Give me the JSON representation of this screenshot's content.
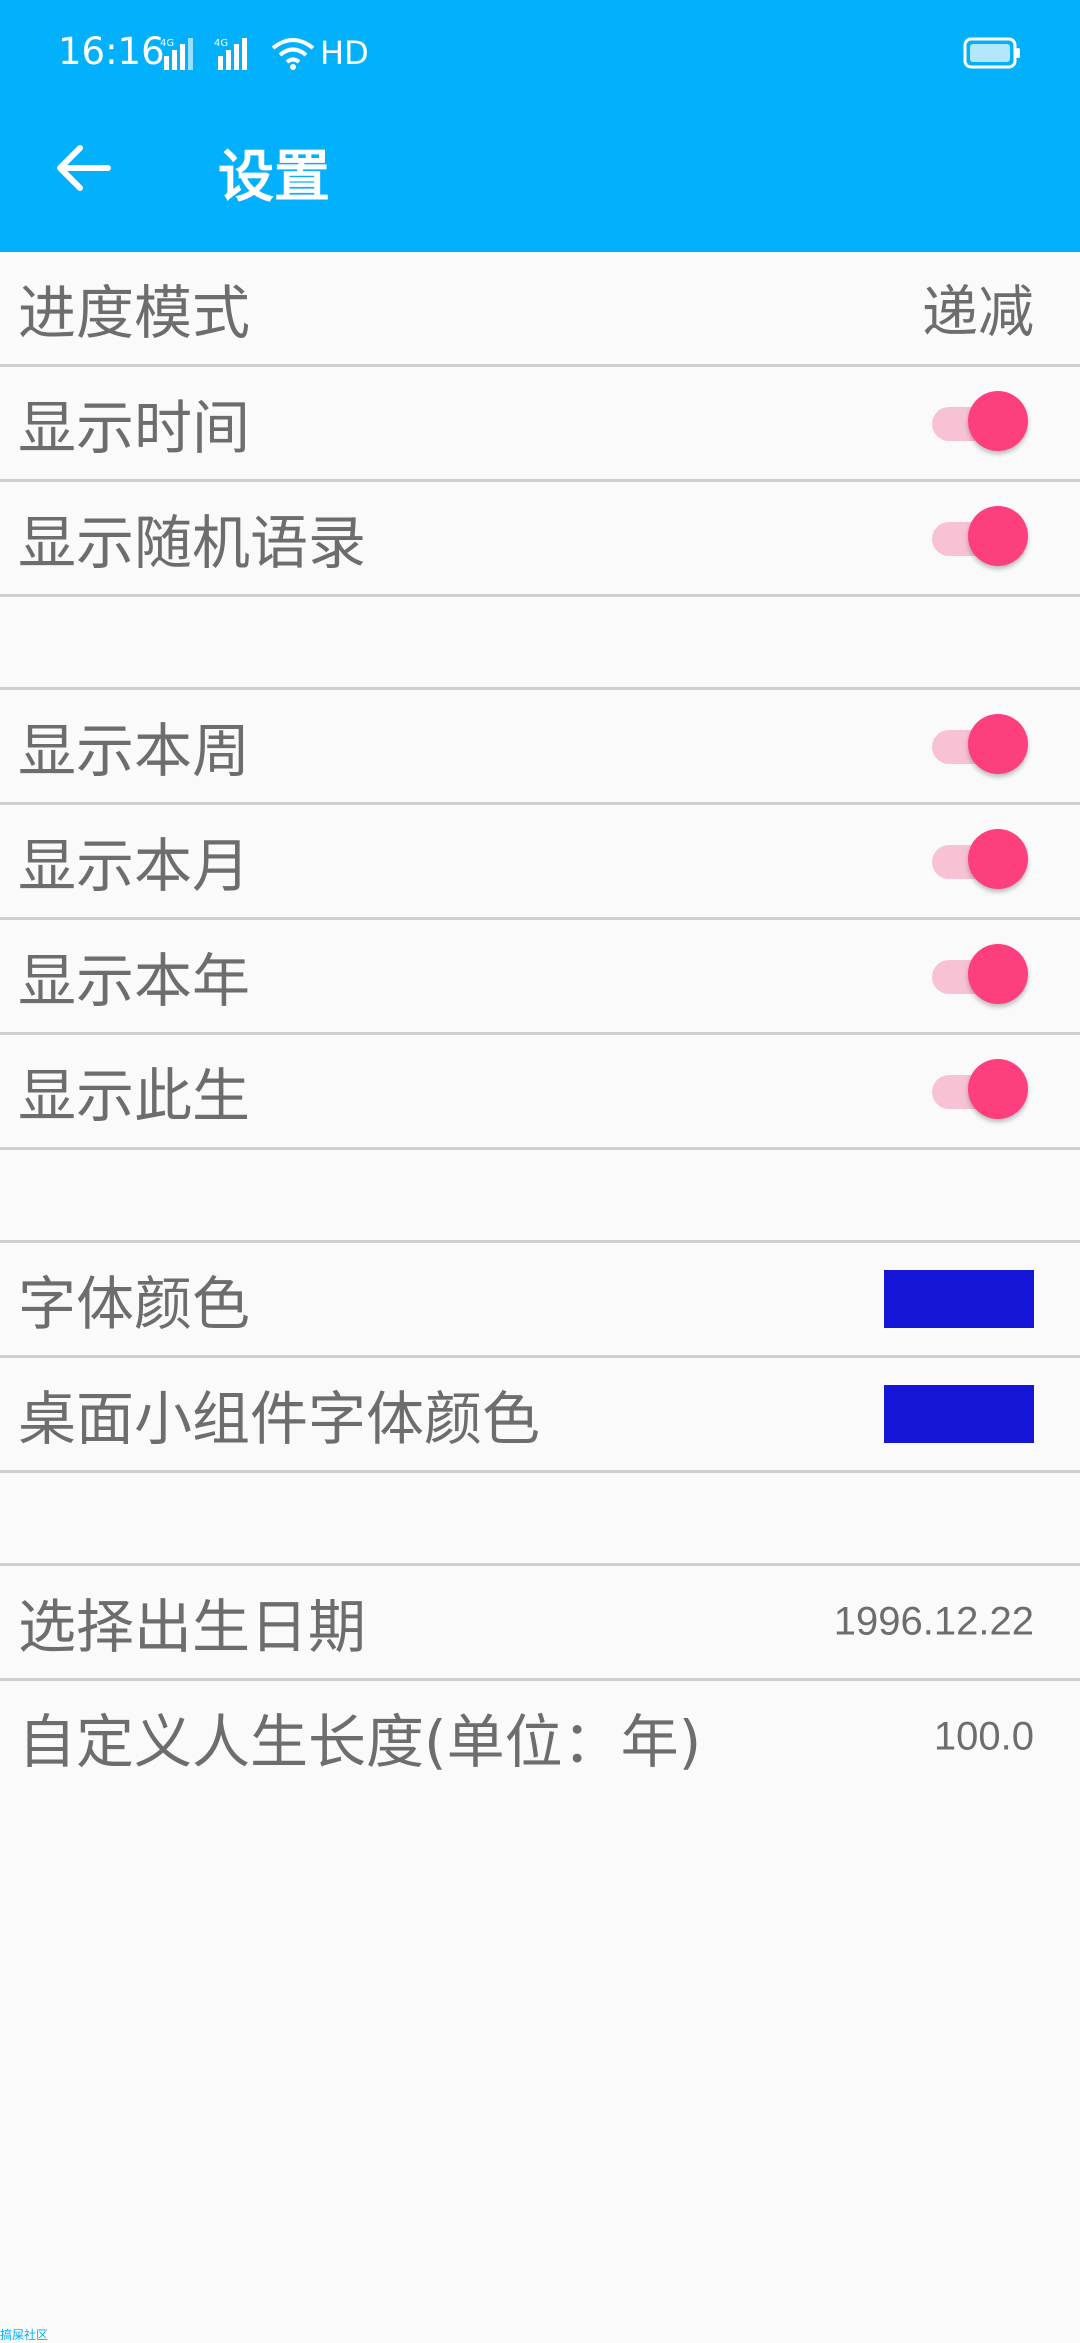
{
  "status_bar": {
    "time": "16:16",
    "network_label": "HD"
  },
  "app_bar": {
    "title": "设置"
  },
  "colors": {
    "primary": "#03b0fb",
    "accent": "#fe3f7d",
    "font_color": "#1616d8"
  },
  "settings": {
    "progress_mode": {
      "label": "进度模式",
      "value": "递减"
    },
    "show_time": {
      "label": "显示时间",
      "checked": true
    },
    "show_quote": {
      "label": "显示随机语录",
      "checked": true
    },
    "show_week": {
      "label": "显示本周",
      "checked": true
    },
    "show_month": {
      "label": "显示本月",
      "checked": true
    },
    "show_year": {
      "label": "显示本年",
      "checked": true
    },
    "show_life": {
      "label": "显示此生",
      "checked": true
    },
    "font_color": {
      "label": "字体颜色",
      "color": "#1616d8"
    },
    "widget_font_color": {
      "label": "桌面小组件字体颜色",
      "color": "#1616d8"
    },
    "birth_date": {
      "label": "选择出生日期",
      "value": "1996.12.22"
    },
    "life_length": {
      "label": "自定义人生长度(单位：年)",
      "value": "100.0"
    }
  },
  "footer": {
    "mark": "搞屎社区"
  }
}
